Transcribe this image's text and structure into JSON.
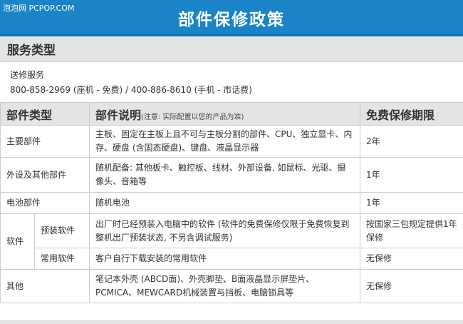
{
  "watermark": "泡泡网 PCPOP.COM",
  "banner": {
    "title": "部件保修政策"
  },
  "service": {
    "heading": "服务类型",
    "type": "送修服务",
    "phones": "800-858-2969 (座机 - 免费) / 400-886-8610 (手机 - 市话费)"
  },
  "table": {
    "headers": {
      "type": "部件类型",
      "desc": "部件说明",
      "desc_note": "(注意: 实际配置以您的产品为准)",
      "period": "免费保修期限"
    },
    "rows": [
      {
        "type": "主要部件",
        "desc": "主板、固定在主板上且不可与主板分割的部件、CPU、独立显卡、内存、硬盘 (含固态硬盘)、键盘、液晶显示器",
        "period": "2年"
      },
      {
        "type": "外设及其他部件",
        "desc": "随机配备: 其他板卡、触控板、线材、外部设备, 如鼠标、光驱、摄像头、音箱等",
        "period": "1年"
      },
      {
        "type": "电池部件",
        "desc": "随机电池",
        "period": "1年"
      },
      {
        "group": "软件",
        "type": "预装软件",
        "desc": "出厂时已经预装入电脑中的软件 (软件的免费保修仅限于免费恢复到整机出厂预装状态, 不另含调试服务)",
        "period": "按国家三包规定提供1年保修"
      },
      {
        "type": "常用软件",
        "desc": "客户自行下载安装的常用软件",
        "period": "无保修"
      },
      {
        "type": "其他",
        "desc": "笔记本外壳 (ABCD面)、外壳脚垫、B面液晶显示屏垫片、PCMICA、MEWCARD机械装置与挡板、电脑锁具等",
        "period": "无保修"
      }
    ]
  },
  "colors": {
    "banner": "#1a84c8",
    "header_gray": "#e4e4e4",
    "text": "#333333"
  }
}
